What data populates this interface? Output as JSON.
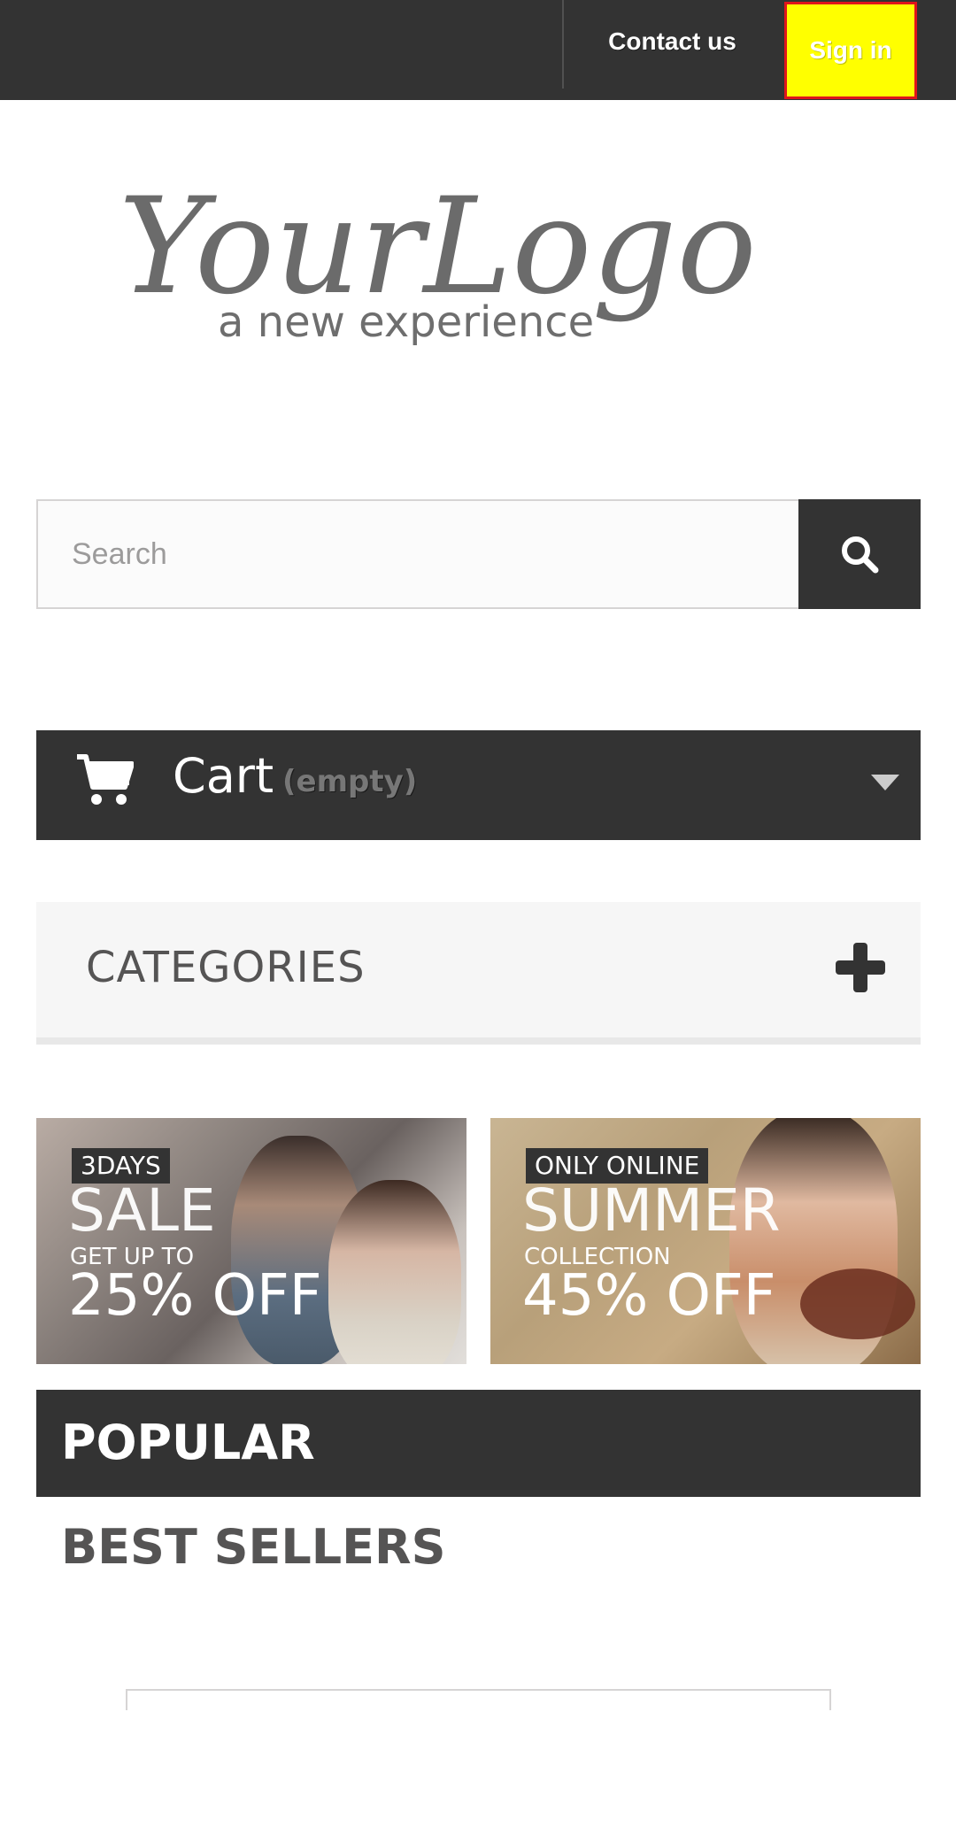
{
  "header": {
    "contact_label": "Contact us",
    "signin_label": "Sign in"
  },
  "logo": {
    "main_text": "YourLogo",
    "tagline": "a new experience"
  },
  "search": {
    "placeholder": "Search",
    "icon": "search-icon"
  },
  "cart": {
    "label": "Cart",
    "status": "(empty)",
    "icon": "cart-icon"
  },
  "categories": {
    "title": "CATEGORIES",
    "icon": "plus-icon"
  },
  "banners": [
    {
      "tag": "3DAYS",
      "headline": "SALE",
      "subline": "GET UP TO",
      "offer": "25% OFF"
    },
    {
      "tag": "ONLY ONLINE",
      "headline": "SUMMER",
      "subline": "COLLECTION",
      "offer": "45% OFF"
    }
  ],
  "tabs": {
    "popular": "POPULAR",
    "best_sellers": "BEST SELLERS"
  },
  "colors": {
    "dark": "#333333",
    "signin_highlight": "#ffff00",
    "signin_border": "#e0151b",
    "panel": "#f6f6f6"
  }
}
